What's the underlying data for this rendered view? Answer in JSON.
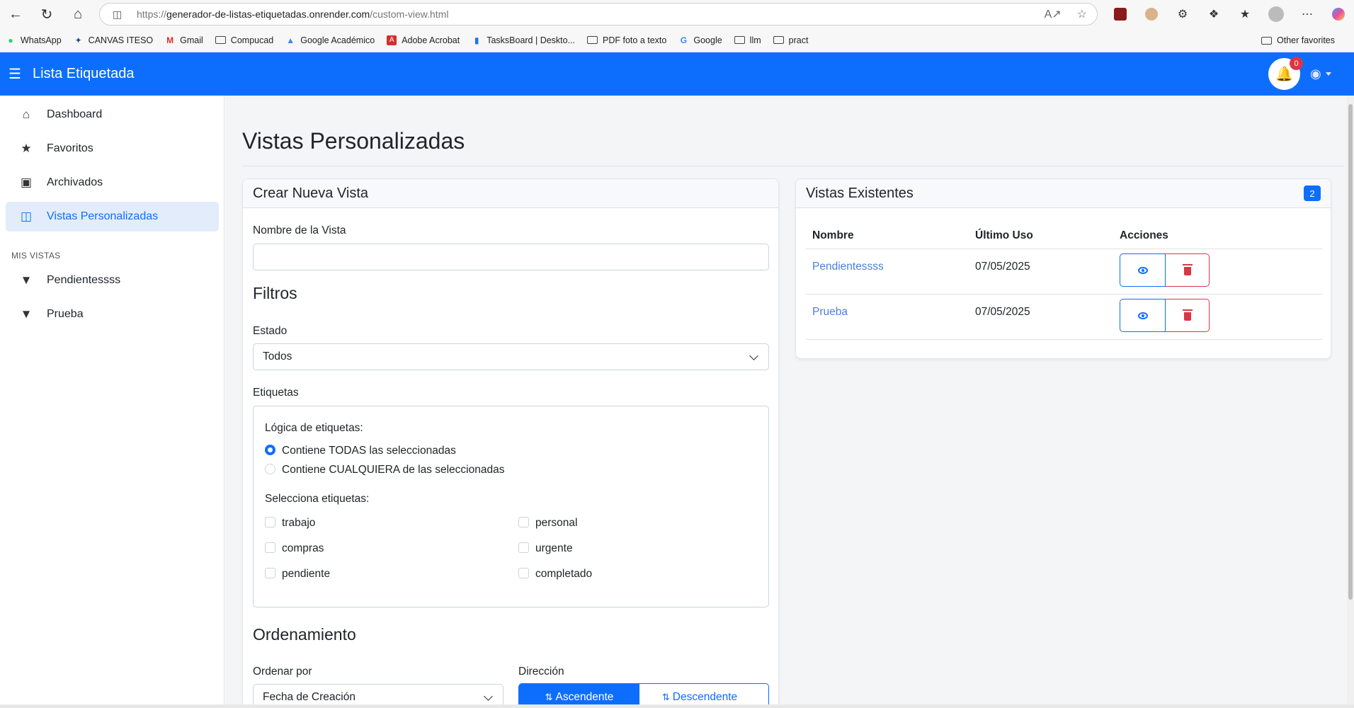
{
  "browser": {
    "url_prefix": "https://",
    "url_host": "generador-de-listas-etiquetadas.onrender.com",
    "url_path": "/custom-view.html",
    "bookmarks": [
      {
        "label": "WhatsApp",
        "icon": "whatsapp-icon"
      },
      {
        "label": "CANVAS ITESO",
        "icon": "canvas-icon"
      },
      {
        "label": "Gmail",
        "icon": "gmail-icon"
      },
      {
        "label": "Compucad",
        "icon": "folder-icon"
      },
      {
        "label": "Google Académico",
        "icon": "scholar-icon"
      },
      {
        "label": "Adobe Acrobat",
        "icon": "acrobat-icon"
      },
      {
        "label": "TasksBoard | Deskto...",
        "icon": "tasksboard-icon"
      },
      {
        "label": "PDF foto a texto",
        "icon": "folder-icon"
      },
      {
        "label": "Google",
        "icon": "google-icon"
      },
      {
        "label": "llm",
        "icon": "folder-icon"
      },
      {
        "label": "pract",
        "icon": "folder-icon"
      }
    ],
    "other_favorites": "Other favorites"
  },
  "navbar": {
    "brand": "Lista Etiquetada",
    "notification_count": "0",
    "accent": "#0d6efd"
  },
  "sidebar": {
    "items": [
      {
        "label": "Dashboard",
        "icon": "home-icon"
      },
      {
        "label": "Favoritos",
        "icon": "star-icon"
      },
      {
        "label": "Archivados",
        "icon": "archive-icon"
      },
      {
        "label": "Vistas Personalizadas",
        "icon": "columns-icon",
        "active": true
      }
    ],
    "section_heading": "MIS VISTAS",
    "views": [
      {
        "label": "Pendientessss",
        "icon": "filter-icon"
      },
      {
        "label": "Prueba",
        "icon": "filter-icon"
      }
    ]
  },
  "main": {
    "title": "Vistas Personalizadas",
    "create_card": {
      "header": "Crear Nueva Vista",
      "name_label": "Nombre de la Vista",
      "name_value": "",
      "filters_title": "Filtros",
      "estado_label": "Estado",
      "estado_value": "Todos",
      "etiquetas_label": "Etiquetas",
      "logic_label": "Lógica de etiquetas:",
      "logic_options": [
        "Contiene TODAS las seleccionadas",
        "Contiene CUALQUIERA de las seleccionadas"
      ],
      "logic_selected": 0,
      "select_tags_label": "Selecciona etiquetas:",
      "tags": [
        "trabajo",
        "personal",
        "compras",
        "urgente",
        "pendiente",
        "completado"
      ],
      "order_title": "Ordenamiento",
      "order_by_label": "Ordenar por",
      "order_by_value": "Fecha de Creación",
      "direction_label": "Dirección",
      "direction_asc": "Ascendente",
      "direction_desc": "Descendente"
    },
    "existing_card": {
      "header": "Vistas Existentes",
      "count": "2",
      "columns": [
        "Nombre",
        "Último Uso",
        "Acciones"
      ],
      "rows": [
        {
          "name": "Pendientessss",
          "last_used": "07/05/2025"
        },
        {
          "name": "Prueba",
          "last_used": "07/05/2025"
        }
      ]
    }
  }
}
